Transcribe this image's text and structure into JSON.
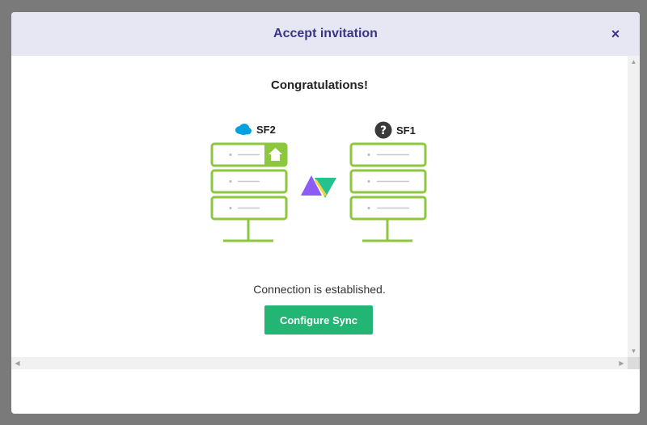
{
  "modal": {
    "title": "Accept invitation",
    "close_icon": "×"
  },
  "content": {
    "heading": "Congratulations!",
    "status": "Connection is established.",
    "configure_button": "Configure Sync"
  },
  "servers": [
    {
      "label": "SF2",
      "icon": "salesforce-cloud-icon"
    },
    {
      "label": "SF1",
      "icon": "question-icon"
    }
  ],
  "colors": {
    "header_bg": "#e7e7f3",
    "title": "#3b3587",
    "button": "#22b573",
    "server_stroke": "#8dc63f",
    "salesforce": "#00a1e0"
  },
  "scrollbars": {
    "up": "▲",
    "down": "▼",
    "left": "◀",
    "right": "▶"
  }
}
